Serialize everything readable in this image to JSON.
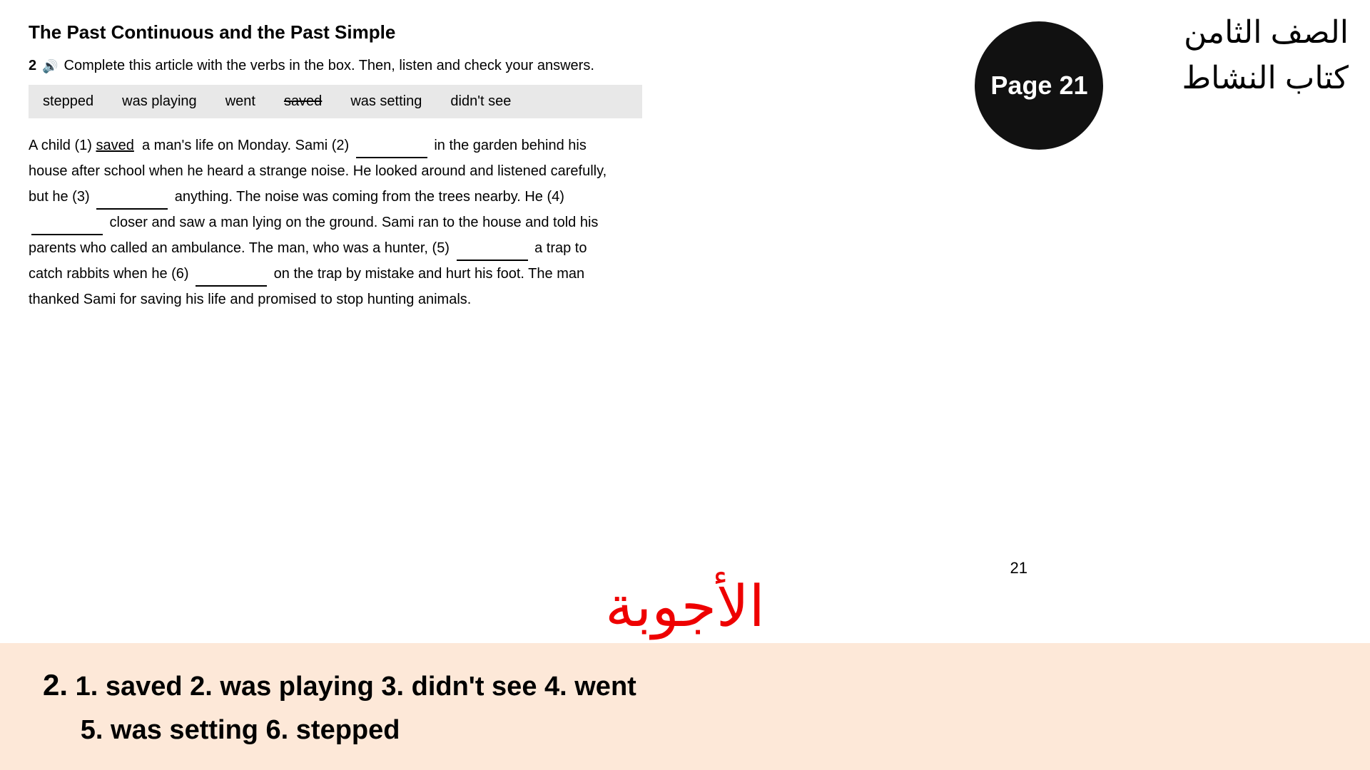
{
  "title": "The Past Continuous and the Past Simple",
  "exercise": {
    "number": "2",
    "speaker": "🔊",
    "instruction": "Complete this article with the verbs in the box. Then, listen and check your answers.",
    "words": [
      "stepped",
      "was playing",
      "went",
      "saved",
      "was setting",
      "didn't see"
    ],
    "strikethrough_word": "saved",
    "article_parts": [
      "A child (1) ",
      " a man's life on Monday. Sami (2) ",
      " in the garden behind his house after school when he heard a strange noise. He looked around and listened carefully, but he (3) ",
      " anything. The noise was coming from the trees nearby. He (4) ",
      " closer and saw a man lying on the ground. Sami ran to the house and told his parents who called an ambulance. The man, who was a hunter, (5) ",
      " a trap to catch rabbits when he (6) ",
      " on the trap by mistake and hurt his foot. The man thanked Sami for saving his life and promised to stop hunting animals."
    ]
  },
  "page_badge": {
    "label": "Page 21"
  },
  "arabic": {
    "line1": "الصف الثامن",
    "line2": "كتاب النشاط"
  },
  "answers_section": {
    "label": "الأجوبة",
    "page_number": "21",
    "exercise_number": "2.",
    "answers_line1": "1. saved  2. was playing  3. didn't see  4. went",
    "answers_line2": "5. was setting  6. stepped"
  }
}
